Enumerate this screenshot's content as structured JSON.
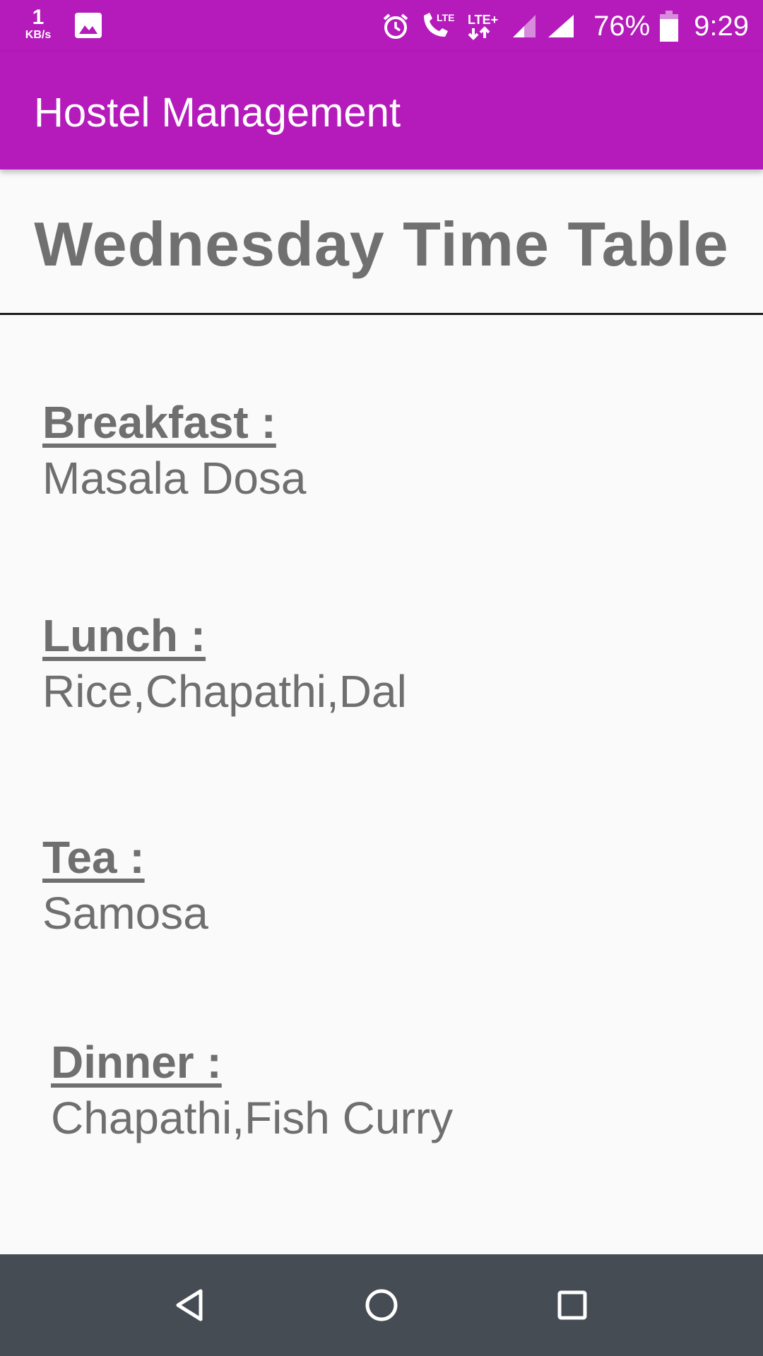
{
  "status_bar": {
    "net_speed_value": "1",
    "net_speed_unit": "KB/s",
    "icons": [
      "gallery-icon",
      "alarm-icon",
      "lte-call-icon",
      "lte-plus-data-icon",
      "signal-icon",
      "signal-icon"
    ],
    "battery_percent": "76%",
    "time": "9:29"
  },
  "app_bar": {
    "title": "Hostel Management",
    "color": "#b41bba"
  },
  "page": {
    "heading": "Wednesday Time Table",
    "meals": [
      {
        "label": "Breakfast :",
        "item": "Masala Dosa"
      },
      {
        "label": "Lunch :",
        "item": "Rice,Chapathi,Dal"
      },
      {
        "label": "Tea :",
        "item": "Samosa"
      },
      {
        "label": "Dinner :",
        "item": "Chapathi,Fish Curry"
      }
    ]
  },
  "nav_bar": {
    "icons": [
      "back-icon",
      "home-icon",
      "recents-icon"
    ]
  }
}
